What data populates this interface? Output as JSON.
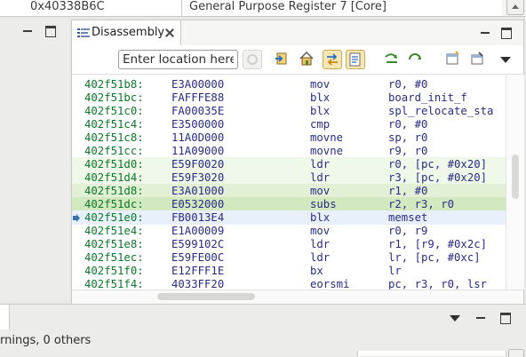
{
  "register_row": {
    "value": "0x40338B6C",
    "name": "General Purpose Register 7 [Core]"
  },
  "disassembly": {
    "tab_label": "Disassembly",
    "location_placeholder": "Enter location here",
    "rows": [
      {
        "addr": "402f51b8:",
        "opcode": "E3A00000",
        "mnemonic": "mov",
        "operands": "r0, #0",
        "highlight": "none"
      },
      {
        "addr": "402f51bc:",
        "opcode": "FAFFFE88",
        "mnemonic": "blx",
        "operands": "board_init_f",
        "highlight": "none"
      },
      {
        "addr": "402f51c0:",
        "opcode": "FA00035E",
        "mnemonic": "blx",
        "operands": "spl_relocate_sta",
        "highlight": "none"
      },
      {
        "addr": "402f51c4:",
        "opcode": "E3500000",
        "mnemonic": "cmp",
        "operands": "r0, #0",
        "highlight": "none"
      },
      {
        "addr": "402f51c8:",
        "opcode": "11A0D000",
        "mnemonic": "movne",
        "operands": "sp, r0",
        "highlight": "none"
      },
      {
        "addr": "402f51cc:",
        "opcode": "11A09000",
        "mnemonic": "movne",
        "operands": "r9, r0",
        "highlight": "none"
      },
      {
        "addr": "402f51d0:",
        "opcode": "E59F0020",
        "mnemonic": "ldr",
        "operands": "r0, [pc, #0x20]",
        "highlight": "light"
      },
      {
        "addr": "402f51d4:",
        "opcode": "E59F3020",
        "mnemonic": "ldr",
        "operands": "r3, [pc, #0x20]",
        "highlight": "light"
      },
      {
        "addr": "402f51d8:",
        "opcode": "E3A01000",
        "mnemonic": "mov",
        "operands": "r1, #0",
        "highlight": "medium"
      },
      {
        "addr": "402f51dc:",
        "opcode": "E0532000",
        "mnemonic": "subs",
        "operands": "r2, r3, r0",
        "highlight": "strong"
      },
      {
        "addr": "402f51e0:",
        "opcode": "FB0013E4",
        "mnemonic": "blx",
        "operands": "memset",
        "highlight": "current"
      },
      {
        "addr": "402f51e4:",
        "opcode": "E1A00009",
        "mnemonic": "mov",
        "operands": "r0, r9",
        "highlight": "none"
      },
      {
        "addr": "402f51e8:",
        "opcode": "E599102C",
        "mnemonic": "ldr",
        "operands": "r1, [r9, #0x2c]",
        "highlight": "none"
      },
      {
        "addr": "402f51ec:",
        "opcode": "E59FE00C",
        "mnemonic": "ldr",
        "operands": "lr, [pc, #0xc]",
        "highlight": "none"
      },
      {
        "addr": "402f51f0:",
        "opcode": "E12FFF1E",
        "mnemonic": "bx",
        "operands": "lr",
        "highlight": "none"
      },
      {
        "addr": "402f51f4:",
        "opcode": "4033FF20",
        "mnemonic": "eorsmi",
        "operands": "pc, r3, r0, lsr",
        "highlight": "none"
      }
    ]
  },
  "problems": {
    "summary": "rnings, 0 others"
  },
  "colors": {
    "address": "#0a7a28",
    "code": "#2a2c87",
    "highlight_light": "#eff8e9",
    "highlight_medium": "#e2f1d6",
    "highlight_strong": "#d2e9bf",
    "current_line": "#e8f1fb"
  }
}
